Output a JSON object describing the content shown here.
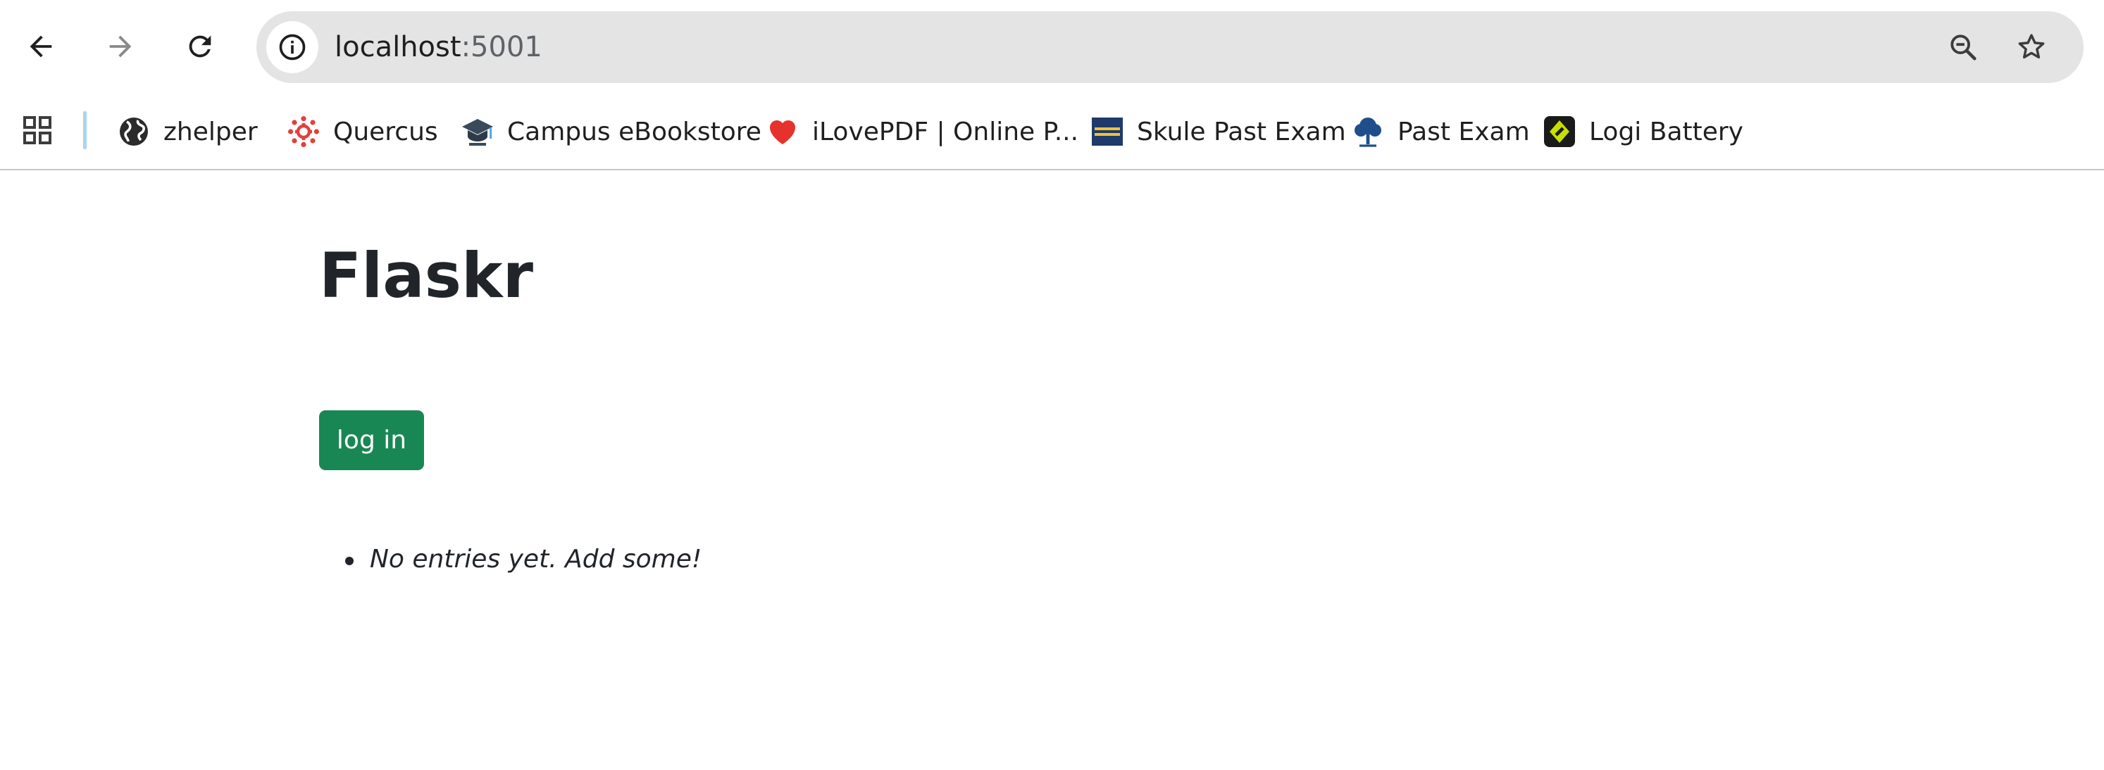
{
  "browser": {
    "url_host": "localhost",
    "url_port": ":5001",
    "icons": {
      "back": "arrow-left-icon",
      "forward": "arrow-right-icon",
      "reload": "reload-icon",
      "site_info": "info-icon",
      "zoom": "zoom-out-icon",
      "bookmark": "star-icon",
      "apps": "apps-grid-icon"
    },
    "bookmarks": [
      {
        "label": "zhelper",
        "icon": "globe-icon"
      },
      {
        "label": "Quercus",
        "icon": "quercus-icon"
      },
      {
        "label": "Campus eBookstore",
        "icon": "graduation-cap-icon"
      },
      {
        "label": "iLovePDF | Online P...",
        "icon": "heart-icon"
      },
      {
        "label": "Skule Past Exam",
        "icon": "skule-icon"
      },
      {
        "label": "Past Exam",
        "icon": "tree-icon"
      },
      {
        "label": "Logi Battery",
        "icon": "logi-icon"
      }
    ]
  },
  "page": {
    "title": "Flaskr",
    "login_label": "log in",
    "entries": [
      "No entries yet. Add some!"
    ]
  },
  "colors": {
    "login_button": "#198754",
    "omnibox_bg": "#e4e4e4",
    "bookmark_separator": "#a8d5ef"
  }
}
